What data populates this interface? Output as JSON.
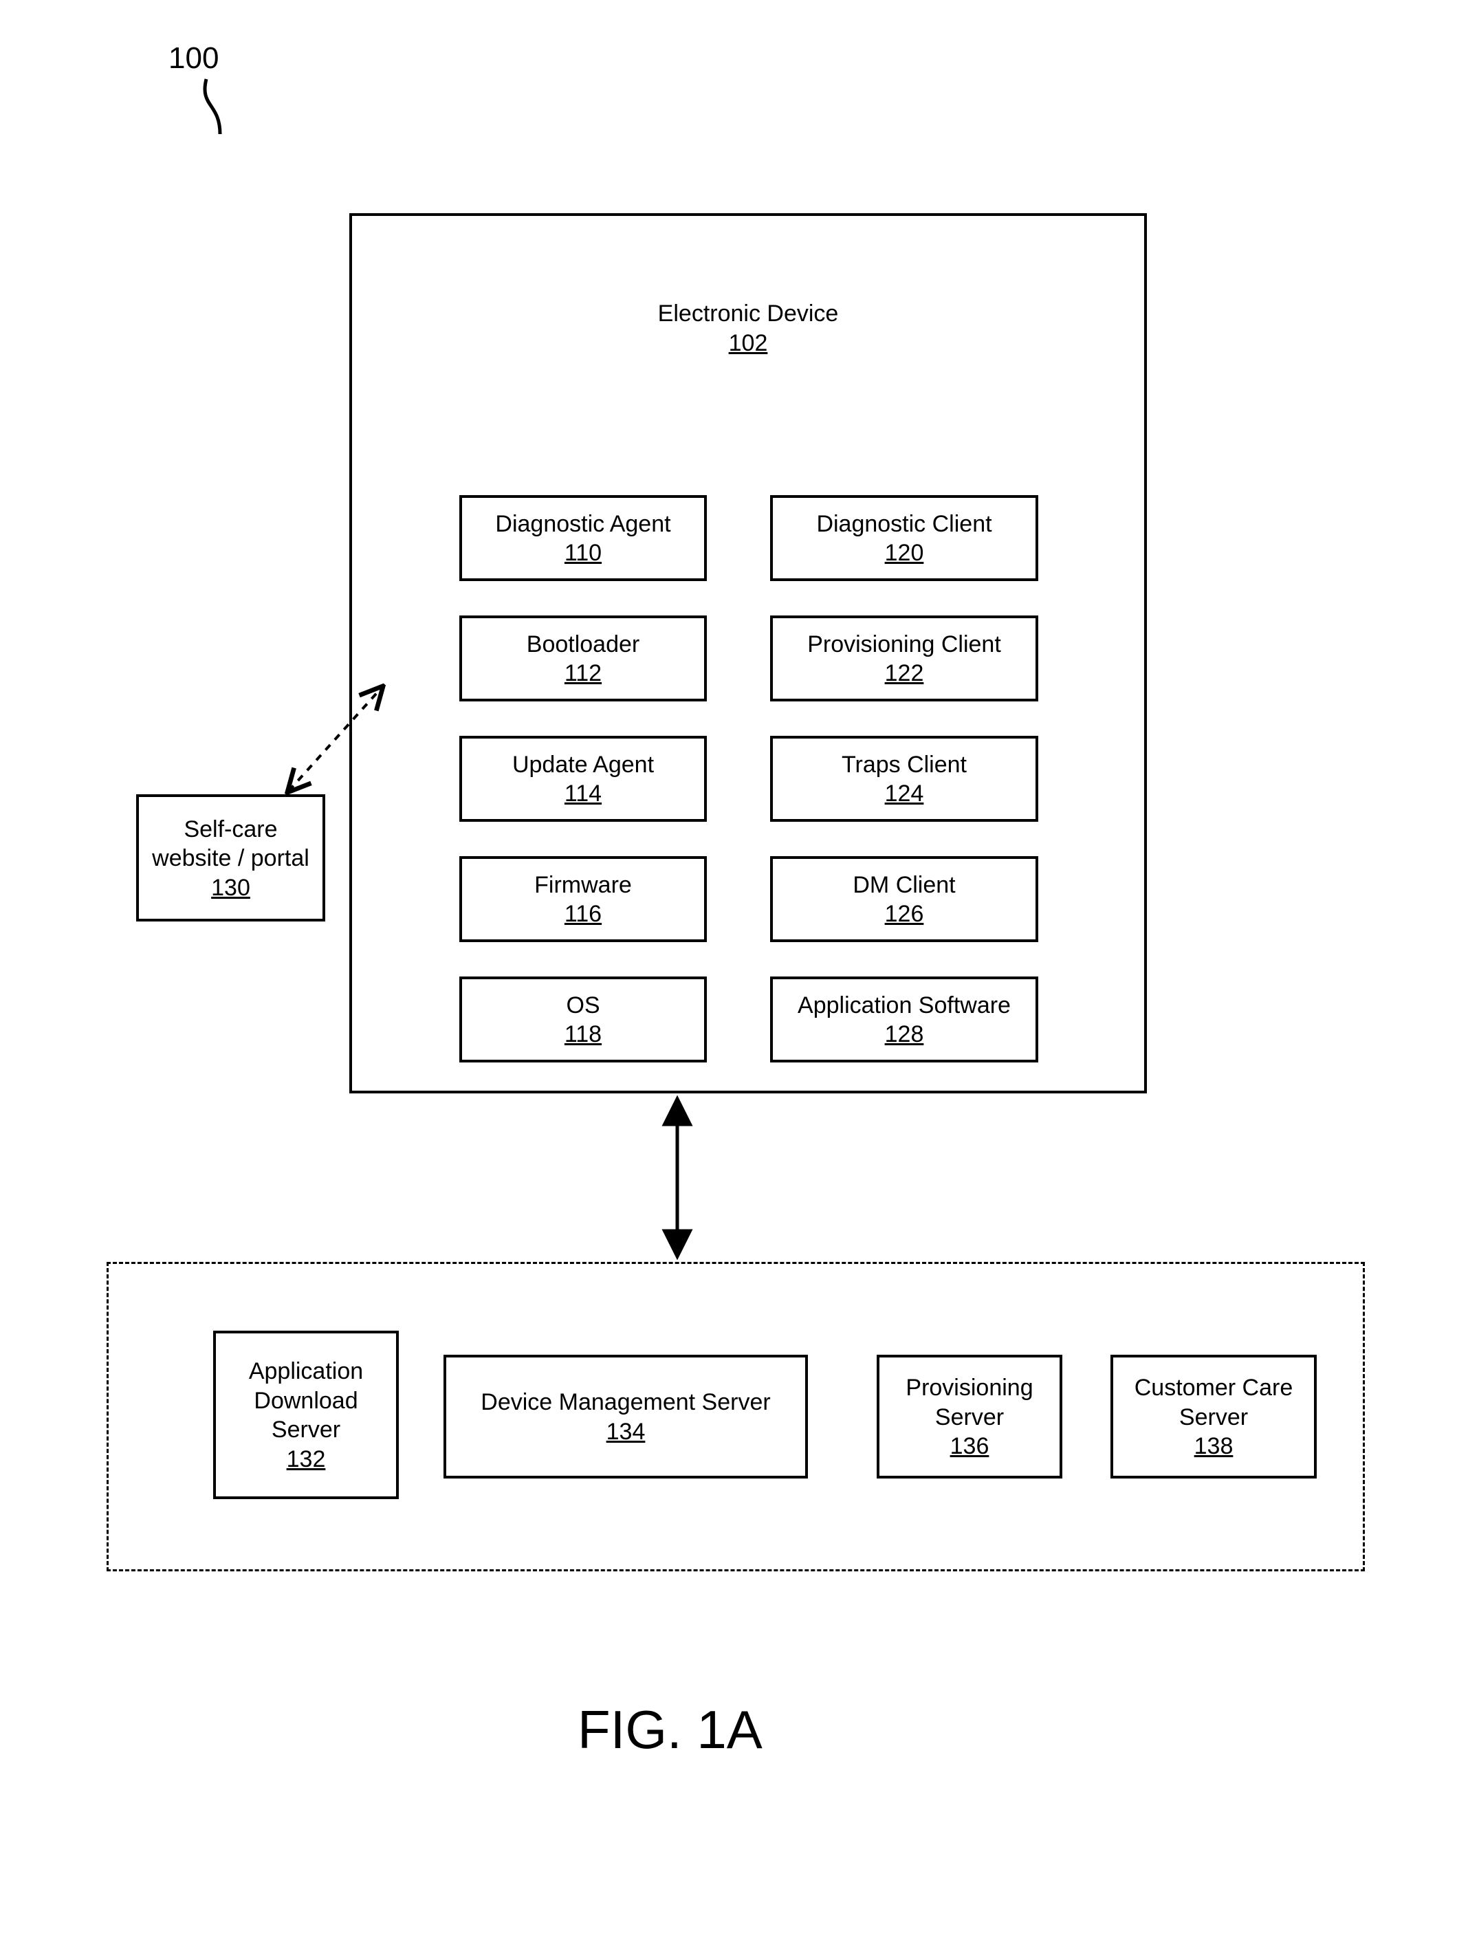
{
  "figure_ref": "100",
  "figure_label": "FIG. 1A",
  "device": {
    "title": "Electronic Device",
    "num": "102"
  },
  "left_col": [
    {
      "label": "Diagnostic Agent",
      "num": "110"
    },
    {
      "label": "Bootloader",
      "num": "112"
    },
    {
      "label": "Update Agent",
      "num": "114"
    },
    {
      "label": "Firmware",
      "num": "116"
    },
    {
      "label": "OS",
      "num": "118"
    }
  ],
  "right_col": [
    {
      "label": "Diagnostic Client",
      "num": "120"
    },
    {
      "label": "Provisioning Client",
      "num": "122"
    },
    {
      "label": "Traps Client",
      "num": "124"
    },
    {
      "label": "DM Client",
      "num": "126"
    },
    {
      "label": "Application Software",
      "num": "128"
    }
  ],
  "selfcare": {
    "label": "Self-care website / portal",
    "num": "130"
  },
  "servers": [
    {
      "label": "Application Download Server",
      "num": "132"
    },
    {
      "label": "Device Management Server",
      "num": "134"
    },
    {
      "label": "Provisioning Server",
      "num": "136"
    },
    {
      "label": "Customer Care Server",
      "num": "138"
    }
  ]
}
